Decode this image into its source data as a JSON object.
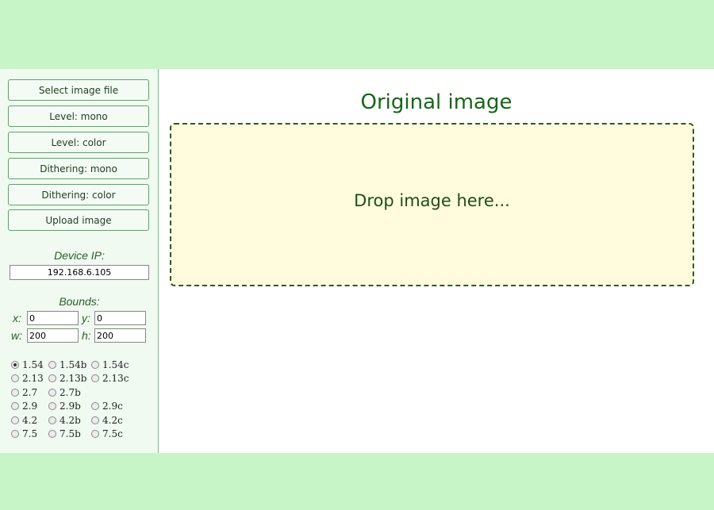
{
  "sidebar": {
    "buttons": [
      "Select image file",
      "Level: mono",
      "Level: color",
      "Dithering: mono",
      "Dithering: color",
      "Upload image"
    ],
    "device_ip_label": "Device IP:",
    "device_ip_value": "192.168.6.105",
    "bounds_label": "Bounds:",
    "bounds": {
      "x_label": "x:",
      "x_value": "0",
      "y_label": "y:",
      "y_value": "0",
      "w_label": "w:",
      "w_value": "200",
      "h_label": "h:",
      "h_value": "200"
    },
    "sizes": [
      "1.54",
      "1.54b",
      "1.54c",
      "2.13",
      "2.13b",
      "2.13c",
      "2.7",
      "2.7b",
      "2.9",
      "2.9b",
      "2.9c",
      "4.2",
      "4.2b",
      "4.2c",
      "7.5",
      "7.5b",
      "7.5c"
    ],
    "selected_size": "1.54"
  },
  "main": {
    "title": "Original image",
    "drop_text": "Drop image here..."
  },
  "colors": {
    "page_bg": "#c8f5c8",
    "accent": "#176617",
    "drop_bg": "#fffbdc"
  }
}
